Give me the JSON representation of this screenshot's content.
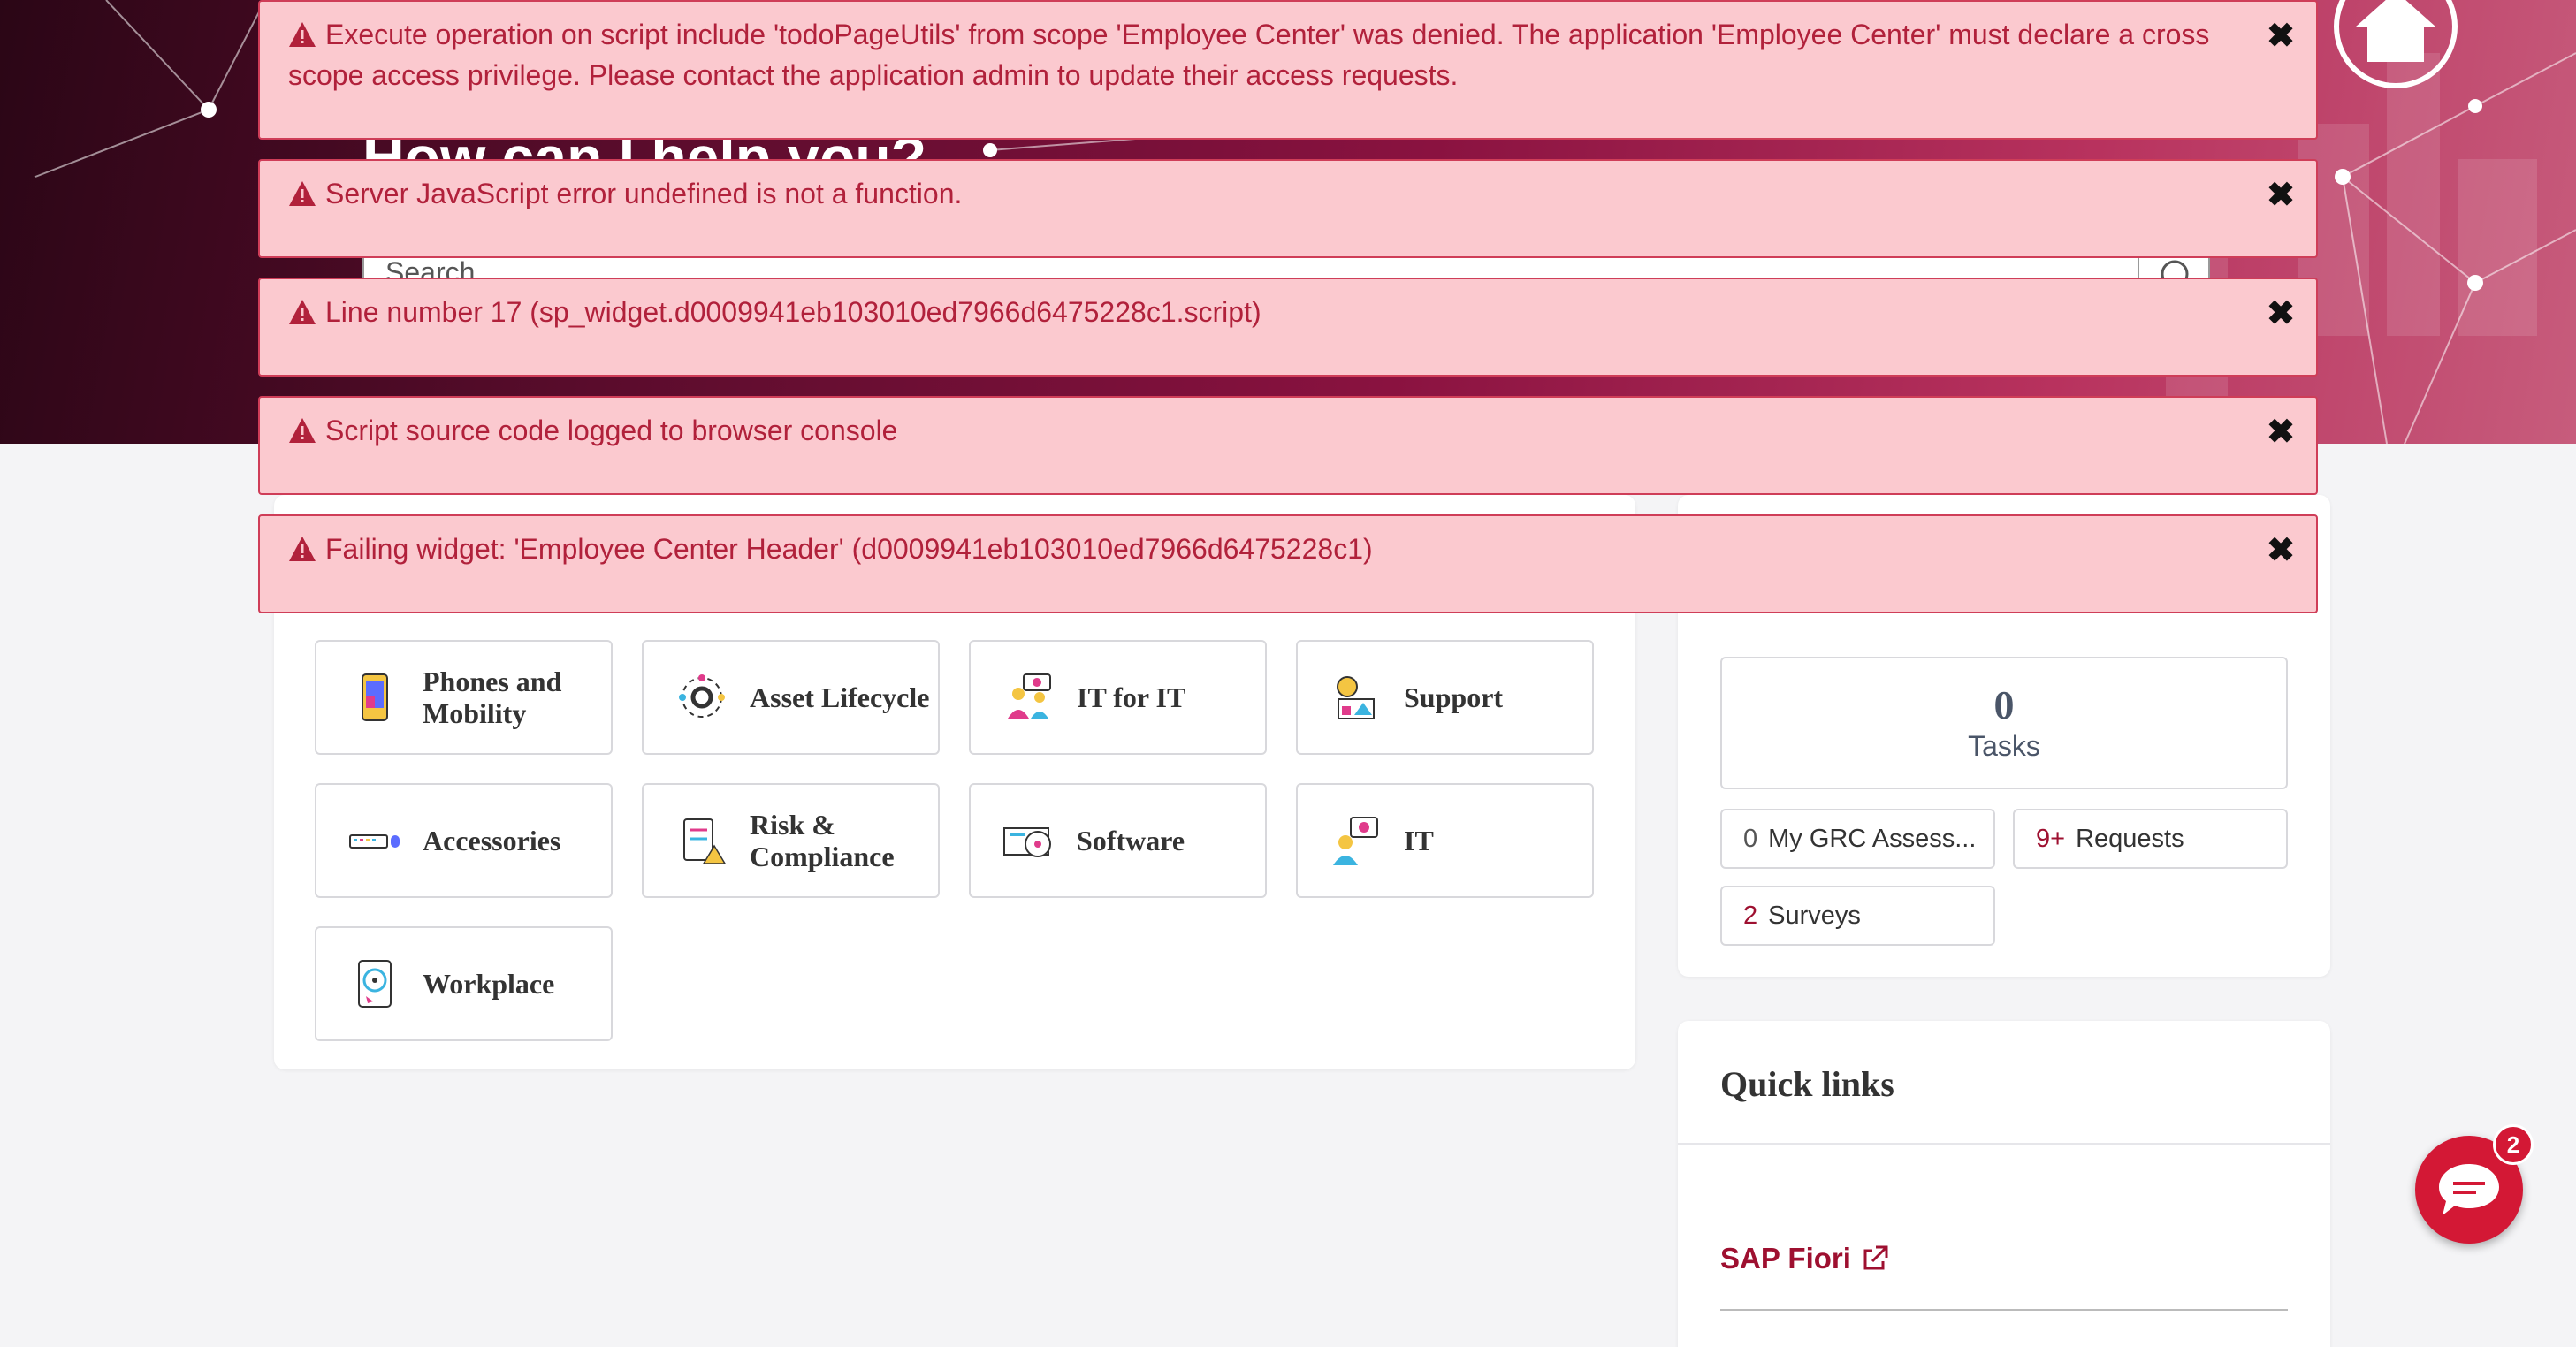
{
  "hero": {
    "title": "How can I help you?",
    "search_placeholder": "Search"
  },
  "alerts": [
    {
      "text": "Execute operation on script include 'todoPageUtils' from scope 'Employee Center' was denied. The application 'Employee Center' must declare a cross scope access privilege. Please contact the application admin to update their access requests."
    },
    {
      "text": "Server JavaScript error undefined is not a function."
    },
    {
      "text": "Line number 17 (sp_widget.d0009941eb103010ed7966d6475228c1.script)"
    },
    {
      "text": "Script source code logged to browser console"
    },
    {
      "text": "Failing widget: 'Employee Center Header' (d0009941eb103010ed7966d6475228c1)"
    }
  ],
  "topics": [
    {
      "label": "Phones and Mobility",
      "icon": "phone-icon"
    },
    {
      "label": "Asset Lifecycle",
      "icon": "gear-cycle-icon"
    },
    {
      "label": "IT for IT",
      "icon": "people-gear-icon"
    },
    {
      "label": "Support",
      "icon": "support-icon"
    },
    {
      "label": "Accessories",
      "icon": "keyboard-icon"
    },
    {
      "label": "Risk & Compliance",
      "icon": "clipboard-warning-icon"
    },
    {
      "label": "Software",
      "icon": "software-disc-icon"
    },
    {
      "label": "IT",
      "icon": "person-gear-icon"
    },
    {
      "label": "Workplace",
      "icon": "hard-drive-icon"
    }
  ],
  "tasks": {
    "count": "0",
    "label": "Tasks",
    "grc": {
      "count": "0",
      "label": "My GRC Assess..."
    },
    "requests": {
      "count": "9+",
      "label": "Requests"
    },
    "surveys": {
      "count": "2",
      "label": "Surveys"
    }
  },
  "quick_links": {
    "title": "Quick links",
    "items": [
      {
        "label": "SAP Fiori"
      }
    ]
  },
  "chat": {
    "badge": "2"
  },
  "colors": {
    "brand": "#9e1030",
    "alert_bg": "#fbc9cf",
    "alert_text": "#b1213b",
    "chat": "#d31835"
  }
}
